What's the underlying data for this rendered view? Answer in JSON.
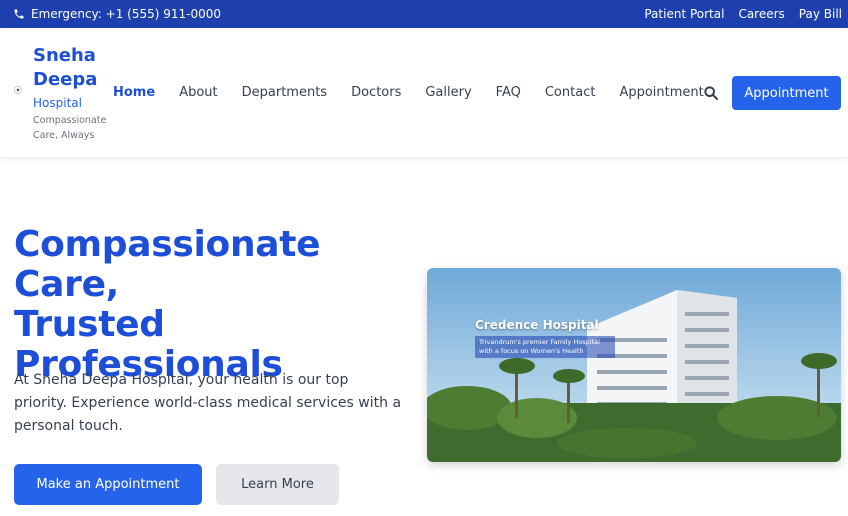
{
  "topbar": {
    "emergency": "Emergency: +1 (555) 911-0000",
    "links": [
      "Patient Portal",
      "Careers",
      "Pay Bill"
    ]
  },
  "brand": {
    "name_line1": "Sneha",
    "name_line2": "Deepa",
    "subtitle": "Hospital",
    "tagline_line1": "Compassionate",
    "tagline_line2": "Care, Always"
  },
  "nav": {
    "items": [
      "Home",
      "About",
      "Departments",
      "Doctors",
      "Gallery",
      "FAQ",
      "Contact",
      "Appointment"
    ],
    "active": "Home",
    "cta": "Appointment"
  },
  "hero": {
    "title_line1": "Compassionate Care,",
    "title_line2": "Trusted",
    "title_line3": "Professionals",
    "text": "At Sneha Deepa Hospital, your health is our top priority. Experience world-class medical services with a personal touch.",
    "primary_button": "Make an Appointment",
    "secondary_button": "Learn More",
    "image_title": "Credence Hospital",
    "image_subtitle": "Trivandrum's premier Family Hospital with a focus on Women's Health"
  },
  "colors": {
    "brand_blue": "#1d4ed8",
    "button_blue": "#2563eb",
    "topbar_blue": "#1e40af"
  }
}
